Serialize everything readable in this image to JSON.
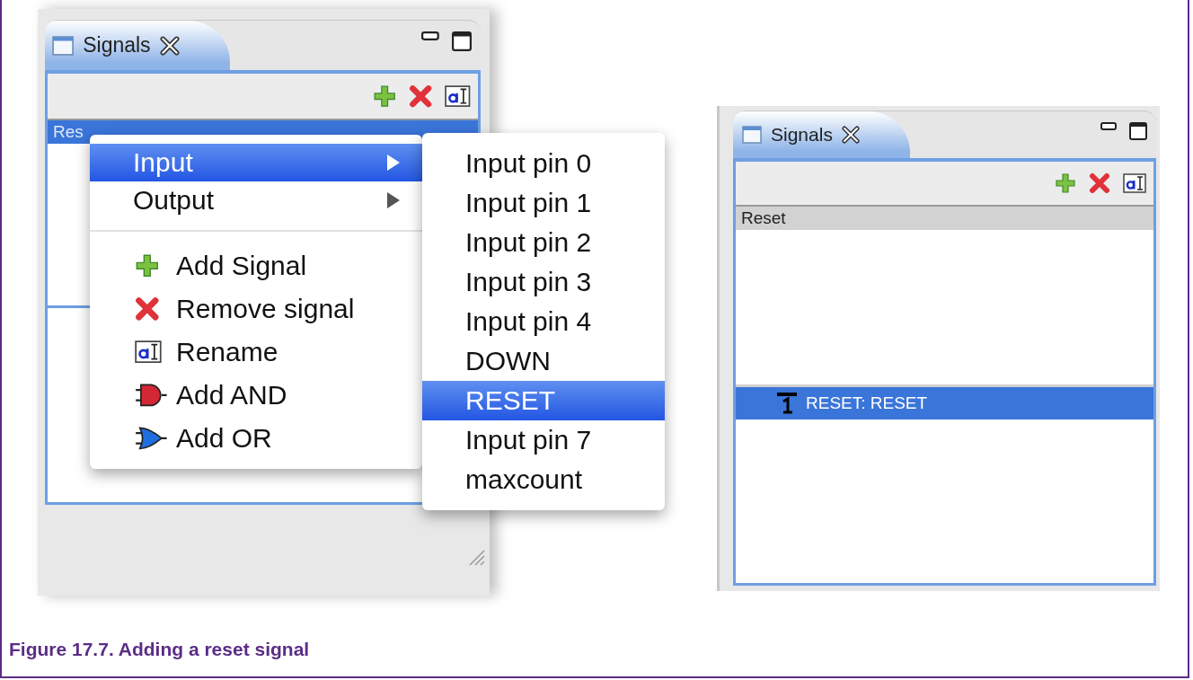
{
  "left_screenshot": {
    "view": {
      "tab_title": "Signals",
      "list_header": {
        "text": "Res",
        "selected": true
      }
    },
    "context_menu": {
      "items": [
        {
          "kind": "submenu",
          "label": "Input",
          "selected": true
        },
        {
          "kind": "submenu",
          "label": "Output",
          "selected": false
        },
        {
          "kind": "separator"
        },
        {
          "kind": "add",
          "label": "Add Signal",
          "selected": false
        },
        {
          "kind": "remove",
          "label": "Remove signal",
          "selected": false
        },
        {
          "kind": "rename",
          "label": "Rename",
          "selected": false
        },
        {
          "kind": "and",
          "label": "Add AND",
          "selected": false
        },
        {
          "kind": "or",
          "label": "Add OR",
          "selected": false
        }
      ]
    },
    "submenu": {
      "items": [
        {
          "label": "Input pin 0",
          "selected": false
        },
        {
          "label": "Input pin 1",
          "selected": false
        },
        {
          "label": "Input pin 2",
          "selected": false
        },
        {
          "label": "Input pin 3",
          "selected": false
        },
        {
          "label": "Input pin 4",
          "selected": false
        },
        {
          "label": "DOWN",
          "selected": false
        },
        {
          "label": "RESET",
          "selected": true
        },
        {
          "label": "Input pin 7",
          "selected": false
        },
        {
          "label": "maxcount",
          "selected": false
        }
      ]
    }
  },
  "right_screenshot": {
    "view": {
      "tab_title": "Signals",
      "list_header": {
        "text": "Reset",
        "selected": false
      },
      "rows": [
        {
          "label": "RESET: RESET",
          "selected": true
        }
      ]
    }
  },
  "caption": "Figure 17.7. Adding a reset signal"
}
